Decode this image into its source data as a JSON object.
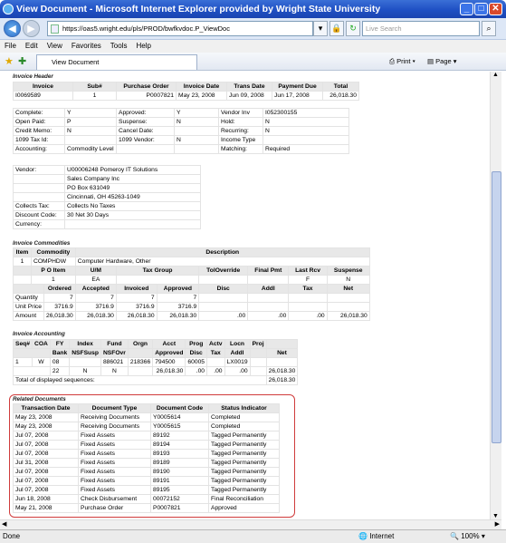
{
  "window": {
    "title": "View Document - Microsoft Internet Explorer provided by Wright State University"
  },
  "address": {
    "url": "https://oas5.wright.edu/pls/PROD/bwfkvdoc.P_ViewDoc",
    "search_placeholder": "Live Search"
  },
  "menu": [
    "File",
    "Edit",
    "View",
    "Favorites",
    "Tools",
    "Help"
  ],
  "tab": {
    "label": "View Document"
  },
  "toolbar": {
    "print": "Print",
    "page": "Page"
  },
  "header": {
    "section": "Invoice Header",
    "columns": [
      "Invoice",
      "Sub#",
      "Purchase Order",
      "Invoice Date",
      "Trans Date",
      "Payment Due",
      "Total"
    ],
    "row": [
      "I0069589",
      "1",
      "P0007821",
      "May 23, 2008",
      "Jun 09, 2008",
      "Jun 17, 2008",
      "26,018.30"
    ],
    "details": [
      [
        "Complete:",
        "Y",
        "Approved:",
        "Y",
        "Vendor Inv",
        "I052300155"
      ],
      [
        "Open Paid:",
        "P",
        "Suspense:",
        "N",
        "Hold:",
        "N"
      ],
      [
        "Credit Memo:",
        "N",
        "Cancel Date:",
        "",
        "Recurring:",
        "N"
      ],
      [
        "1099 Tax Id:",
        "",
        "1099 Vendor:",
        "N",
        "Income Type",
        ""
      ],
      [
        "Accounting:",
        "Commodity Level",
        "",
        "",
        "Matching:",
        "Required"
      ]
    ],
    "vendor": [
      "Vendor:",
      "U00006248 Pomeroy IT Solutions",
      "Sales Company Inc",
      "PO Box 631049",
      "Cincinnati, OH 45263-1049"
    ],
    "collects": [
      "Collects Tax:",
      "Collects No Taxes"
    ],
    "discount": [
      "Discount Code:",
      "30 Net 30 Days"
    ],
    "currency": [
      "Currency:",
      ""
    ]
  },
  "commodities": {
    "section": "Invoice Commodities",
    "h1": [
      "Item",
      "Commodity",
      "Description"
    ],
    "r1": [
      "1",
      "COMPHDW",
      "Computer Hardware, Other"
    ],
    "h2": [
      "P O Item",
      "U/M",
      "Tax Group",
      "TolOverride",
      "Final Pmt",
      "Last Rcv",
      "Suspense"
    ],
    "r2": [
      "1",
      "EA",
      "",
      "",
      "",
      "F",
      "N"
    ],
    "h3": [
      "Ordered",
      "Accepted",
      "Invoiced",
      "Approved",
      "Disc",
      "Addl",
      "Tax",
      "Net"
    ],
    "rows": [
      [
        "Quantity",
        "7",
        "7",
        "7",
        "7",
        "",
        "",
        "",
        ""
      ],
      [
        "Unit Price",
        "3716.9",
        "3716.9",
        "3716.9",
        "3716.9",
        "",
        "",
        "",
        ""
      ],
      [
        "Amount",
        "26,018.30",
        "26,018.30",
        "26,018.30",
        "26,018.30",
        ".00",
        ".00",
        ".00",
        "26,018.30"
      ]
    ]
  },
  "accounting": {
    "section": "Invoice Accounting",
    "h1": [
      "Seq#",
      "COA",
      "FY",
      "Index",
      "Fund",
      "Orgn",
      "Acct",
      "Prog",
      "Actv",
      "Locn",
      "Proj"
    ],
    "h2": [
      "Bank",
      "NSFSusp",
      "NSFOvr",
      "Approved",
      "Disc",
      "Tax",
      "Addl",
      "Net"
    ],
    "r1": [
      "1",
      "W",
      "08",
      "",
      "886021",
      "218366",
      "794500",
      "60005",
      "",
      "LX0019",
      ""
    ],
    "r2": [
      "22",
      "N",
      "N",
      "",
      "26,018.30",
      ".00",
      ".00",
      ".00",
      "26,018.30"
    ],
    "total": [
      "Total of displayed sequences:",
      "26,018.30"
    ]
  },
  "related": {
    "section": "Related Documents",
    "columns": [
      "Transaction Date",
      "Document Type",
      "Document Code",
      "Status Indicator"
    ],
    "rows": [
      [
        "May 23, 2008",
        "Receiving Documents",
        "Y0005614",
        "Completed"
      ],
      [
        "May 23, 2008",
        "Receiving Documents",
        "Y0005615",
        "Completed"
      ],
      [
        "Jul 07, 2008",
        "Fixed Assets",
        "89192",
        "Tagged Permanently"
      ],
      [
        "Jul 07, 2008",
        "Fixed Assets",
        "89194",
        "Tagged Permanently"
      ],
      [
        "Jul 07, 2008",
        "Fixed Assets",
        "89193",
        "Tagged Permanently"
      ],
      [
        "Jul 31, 2008",
        "Fixed Assets",
        "89189",
        "Tagged Permanently"
      ],
      [
        "Jul 07, 2008",
        "Fixed Assets",
        "89190",
        "Tagged Permanently"
      ],
      [
        "Jul 07, 2008",
        "Fixed Assets",
        "89191",
        "Tagged Permanently"
      ],
      [
        "Jul 07, 2008",
        "Fixed Assets",
        "89195",
        "Tagged Permanently"
      ],
      [
        "Jun 18, 2008",
        "Check Disbursement",
        "00072152",
        "Final Reconciliation"
      ],
      [
        "May 21, 2008",
        "Purchase Order",
        "P0007821",
        "Approved"
      ]
    ]
  },
  "statusbar": {
    "left": "Done",
    "zone": "Internet",
    "zoom": "100%"
  }
}
